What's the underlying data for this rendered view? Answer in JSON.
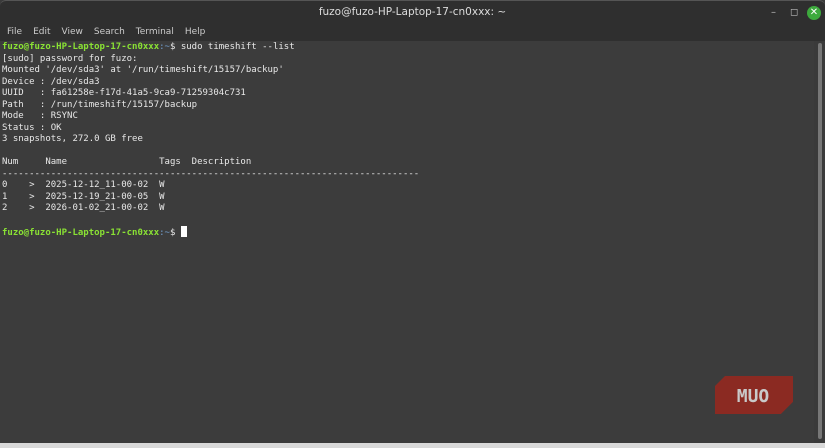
{
  "window": {
    "title": "fuzo@fuzo-HP-Laptop-17-cn0xxx: ~",
    "minimize": "–",
    "maximize": "◻",
    "close": "✕"
  },
  "menu": [
    "File",
    "Edit",
    "View",
    "Search",
    "Terminal",
    "Help"
  ],
  "terminal": {
    "prompt_user": "fuzo@fuzo-HP-Laptop-17-cn0xxx",
    "prompt_path": ":~",
    "prompt_symbol": "$ ",
    "command": "sudo timeshift --list",
    "output": [
      "[sudo] password for fuzo:",
      "Mounted '/dev/sda3' at '/run/timeshift/15157/backup'",
      "Device : /dev/sda3",
      "UUID   : fa61258e-f17d-41a5-9ca9-71259304c731",
      "Path   : /run/timeshift/15157/backup",
      "Mode   : RSYNC",
      "Status : OK",
      "3 snapshots, 272.0 GB free",
      "",
      "Num     Name                 Tags  Description",
      "-----------------------------------------------------------------------------",
      "0    >  2025-12-12_11-00-02  W",
      "1    >  2025-12-19_21-00-05  W",
      "2    >  2026-01-02_21-00-02  W",
      ""
    ]
  },
  "watermark": "MUO"
}
